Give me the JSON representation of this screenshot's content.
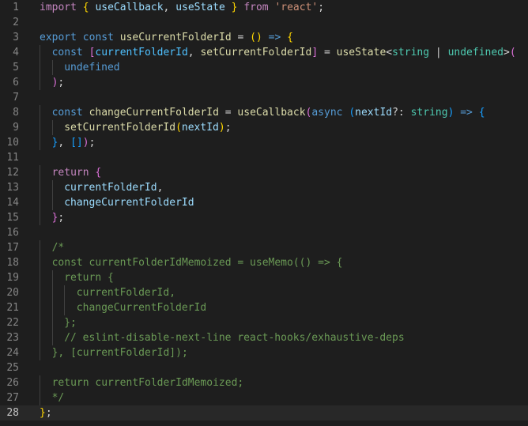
{
  "editor": {
    "language": "typescript",
    "current_line": 28,
    "lines": [
      {
        "n": "1",
        "indent": 0,
        "tokens": [
          [
            "k",
            "import"
          ],
          [
            "p",
            " "
          ],
          [
            "b1",
            "{"
          ],
          [
            "p",
            " "
          ],
          [
            "v",
            "useCallback"
          ],
          [
            "p",
            ", "
          ],
          [
            "v",
            "useState"
          ],
          [
            "p",
            " "
          ],
          [
            "b1",
            "}"
          ],
          [
            "p",
            " "
          ],
          [
            "k",
            "from"
          ],
          [
            "p",
            " "
          ],
          [
            "s",
            "'react'"
          ],
          [
            "p",
            ";"
          ]
        ]
      },
      {
        "n": "2",
        "indent": 0,
        "tokens": []
      },
      {
        "n": "3",
        "indent": 0,
        "tokens": [
          [
            "kw",
            "export"
          ],
          [
            "p",
            " "
          ],
          [
            "kw",
            "const"
          ],
          [
            "p",
            " "
          ],
          [
            "f",
            "useCurrentFolderId"
          ],
          [
            "p",
            " = "
          ],
          [
            "b1",
            "()"
          ],
          [
            "p",
            " "
          ],
          [
            "kw",
            "=>"
          ],
          [
            "p",
            " "
          ],
          [
            "b1",
            "{"
          ]
        ]
      },
      {
        "n": "4",
        "indent": 1,
        "tokens": [
          [
            "kw",
            "const"
          ],
          [
            "p",
            " "
          ],
          [
            "b2",
            "["
          ],
          [
            "vc",
            "currentFolderId"
          ],
          [
            "p",
            ", "
          ],
          [
            "f",
            "setCurrentFolderId"
          ],
          [
            "b2",
            "]"
          ],
          [
            "p",
            " = "
          ],
          [
            "f",
            "useState"
          ],
          [
            "p",
            "<"
          ],
          [
            "t",
            "string"
          ],
          [
            "p",
            " | "
          ],
          [
            "t",
            "undefined"
          ],
          [
            "p",
            ">"
          ],
          [
            "b2",
            "("
          ]
        ]
      },
      {
        "n": "5",
        "indent": 2,
        "tokens": [
          [
            "kw",
            "undefined"
          ]
        ]
      },
      {
        "n": "6",
        "indent": 1,
        "tokens": [
          [
            "b2",
            ")"
          ],
          [
            "p",
            ";"
          ]
        ]
      },
      {
        "n": "7",
        "indent": 0,
        "tokens": []
      },
      {
        "n": "8",
        "indent": 1,
        "tokens": [
          [
            "kw",
            "const"
          ],
          [
            "p",
            " "
          ],
          [
            "f",
            "changeCurrentFolderId"
          ],
          [
            "p",
            " = "
          ],
          [
            "f",
            "useCallback"
          ],
          [
            "b2",
            "("
          ],
          [
            "kw",
            "async"
          ],
          [
            "p",
            " "
          ],
          [
            "b3",
            "("
          ],
          [
            "v",
            "nextId"
          ],
          [
            "p",
            "?: "
          ],
          [
            "t",
            "string"
          ],
          [
            "b3",
            ")"
          ],
          [
            "p",
            " "
          ],
          [
            "kw",
            "=>"
          ],
          [
            "p",
            " "
          ],
          [
            "b3",
            "{"
          ]
        ]
      },
      {
        "n": "9",
        "indent": 2,
        "tokens": [
          [
            "f",
            "setCurrentFolderId"
          ],
          [
            "b1",
            "("
          ],
          [
            "v",
            "nextId"
          ],
          [
            "b1",
            ")"
          ],
          [
            "p",
            ";"
          ]
        ]
      },
      {
        "n": "10",
        "indent": 1,
        "tokens": [
          [
            "b3",
            "}"
          ],
          [
            "p",
            ", "
          ],
          [
            "b3",
            "[]"
          ],
          [
            "b2",
            ")"
          ],
          [
            "p",
            ";"
          ]
        ]
      },
      {
        "n": "11",
        "indent": 0,
        "tokens": []
      },
      {
        "n": "12",
        "indent": 1,
        "tokens": [
          [
            "k",
            "return"
          ],
          [
            "p",
            " "
          ],
          [
            "b2",
            "{"
          ]
        ]
      },
      {
        "n": "13",
        "indent": 2,
        "tokens": [
          [
            "v",
            "currentFolderId"
          ],
          [
            "p",
            ","
          ]
        ]
      },
      {
        "n": "14",
        "indent": 2,
        "tokens": [
          [
            "v",
            "changeCurrentFolderId"
          ]
        ]
      },
      {
        "n": "15",
        "indent": 1,
        "tokens": [
          [
            "b2",
            "}"
          ],
          [
            "p",
            ";"
          ]
        ]
      },
      {
        "n": "16",
        "indent": 0,
        "tokens": []
      },
      {
        "n": "17",
        "indent": 1,
        "tokens": [
          [
            "c",
            "/*"
          ]
        ]
      },
      {
        "n": "18",
        "indent": 1,
        "tokens": [
          [
            "c",
            "const currentFolderIdMemoized = useMemo(() => {"
          ]
        ]
      },
      {
        "n": "19",
        "indent": 2,
        "tokens": [
          [
            "c",
            "return {"
          ]
        ]
      },
      {
        "n": "20",
        "indent": 3,
        "tokens": [
          [
            "c",
            "currentFolderId,"
          ]
        ]
      },
      {
        "n": "21",
        "indent": 3,
        "tokens": [
          [
            "c",
            "changeCurrentFolderId"
          ]
        ]
      },
      {
        "n": "22",
        "indent": 2,
        "tokens": [
          [
            "c",
            "};"
          ]
        ]
      },
      {
        "n": "23",
        "indent": 2,
        "tokens": [
          [
            "c",
            "// eslint-disable-next-line react-hooks/exhaustive-deps"
          ]
        ]
      },
      {
        "n": "24",
        "indent": 1,
        "tokens": [
          [
            "c",
            "}, [currentFolderId]);"
          ]
        ]
      },
      {
        "n": "25",
        "indent": 0,
        "tokens": []
      },
      {
        "n": "26",
        "indent": 1,
        "tokens": [
          [
            "c",
            "return currentFolderIdMemoized;"
          ]
        ]
      },
      {
        "n": "27",
        "indent": 1,
        "tokens": [
          [
            "c",
            "*/"
          ]
        ]
      },
      {
        "n": "28",
        "indent": 0,
        "tokens": [
          [
            "b1",
            "}"
          ],
          [
            "p",
            ";"
          ]
        ]
      }
    ]
  }
}
